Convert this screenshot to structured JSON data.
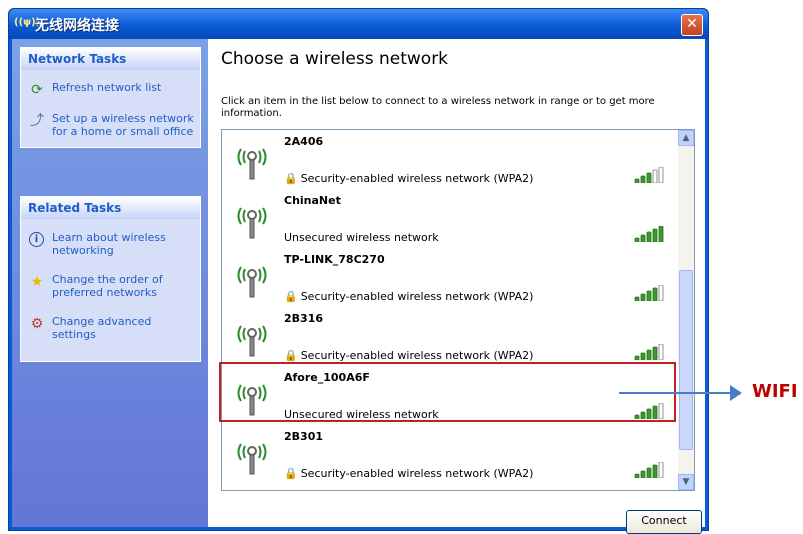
{
  "window": {
    "title": "无线网络连接",
    "title_icon": "((ψ))"
  },
  "sidebar": {
    "network_tasks": {
      "header": "Network Tasks",
      "items": [
        {
          "label": "Refresh network list",
          "icon": "refresh-icon"
        },
        {
          "label": "Set up a wireless network for a home or small office",
          "icon": "setup-wireless-icon"
        }
      ]
    },
    "related_tasks": {
      "header": "Related Tasks",
      "items": [
        {
          "label": "Learn about wireless networking",
          "icon": "info-icon"
        },
        {
          "label": "Change the order of preferred networks",
          "icon": "star-icon"
        },
        {
          "label": "Change advanced settings",
          "icon": "settings-icon"
        }
      ]
    }
  },
  "main": {
    "title": "Choose a wireless network",
    "description": "Click an item in the list below to connect to a wireless network in range or to get more information.",
    "networks": [
      {
        "name": "2A406",
        "security": "Security-enabled wireless network (WPA2)",
        "secured": true,
        "signal_bars": 3
      },
      {
        "name": "ChinaNet",
        "security": "Unsecured wireless network",
        "secured": false,
        "signal_bars": 5
      },
      {
        "name": "TP-LINK_78C270",
        "security": "Security-enabled wireless network (WPA2)",
        "secured": true,
        "signal_bars": 4
      },
      {
        "name": "2B316",
        "security": "Security-enabled wireless network (WPA2)",
        "secured": true,
        "signal_bars": 4
      },
      {
        "name": "Afore_100A6F",
        "security": "Unsecured wireless network",
        "secured": false,
        "signal_bars": 4
      },
      {
        "name": "2B301",
        "security": "Security-enabled wireless network (WPA2)",
        "secured": true,
        "signal_bars": 4
      }
    ],
    "connect_label": "Connect"
  },
  "annotation": {
    "label": "WIFI",
    "color": "#c00000"
  },
  "colors": {
    "titlebar": "#0a5ad6",
    "sidebar_link": "#215dc6",
    "signal_green": "#3a9a2e"
  }
}
